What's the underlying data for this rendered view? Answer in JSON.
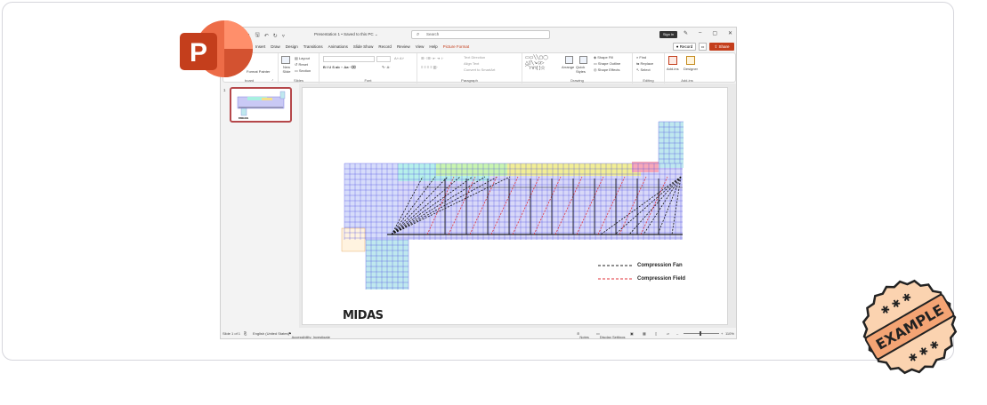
{
  "window": {
    "doc_title": "Presentation 1 • Saved to this PC ⌄",
    "search_placeholder": "Search",
    "sign_in": "Sign in"
  },
  "tabs": [
    "Insert",
    "Draw",
    "Design",
    "Transitions",
    "Animations",
    "Slide Show",
    "Record",
    "Review",
    "View",
    "Help",
    "Picture Format"
  ],
  "ribbon_buttons": {
    "record": "Record",
    "share": "Share"
  },
  "ribbon": {
    "clipboard": {
      "label": "board",
      "format_painter": "Format Painter"
    },
    "slides": {
      "label": "Slides",
      "new_slide": "New Slide",
      "layout": "Layout",
      "reset": "Reset",
      "section": "Section"
    },
    "font": {
      "label": "Font"
    },
    "paragraph": {
      "label": "Paragraph",
      "text_direction": "Text Direction",
      "align_text": "Align Text",
      "convert_smartart": "Convert to SmartArt"
    },
    "drawing": {
      "label": "Drawing",
      "arrange": "Arrange",
      "quick_styles": "Quick Styles",
      "shape_fill": "Shape Fill",
      "shape_outline": "Shape Outline",
      "shape_effects": "Shape Effects"
    },
    "editing": {
      "label": "Editing",
      "find": "Find",
      "replace": "Replace",
      "select": "Select"
    },
    "addins": {
      "label": "Add-ins",
      "addins": "Add-ins",
      "designer": "Designer"
    }
  },
  "thumbnails": [
    {
      "number": "1"
    }
  ],
  "slide": {
    "legend": [
      {
        "label": "Compression Fan",
        "color": "#222222"
      },
      {
        "label": "Compression Field",
        "color": "#e0303a"
      }
    ],
    "logo": "MIDAS"
  },
  "statusbar": {
    "slide_info": "Slide 1 of 1",
    "language": "English (United States)",
    "accessibility": "Accessibility: Investigate",
    "notes": "Notes",
    "display_settings": "Display Settings",
    "zoom": "110%"
  },
  "stamp": {
    "text": "EXAMPLE"
  },
  "colors": {
    "accent": "#c43e1c",
    "thumb_border": "#b5474a",
    "grid_blue": "#4a4adf"
  }
}
